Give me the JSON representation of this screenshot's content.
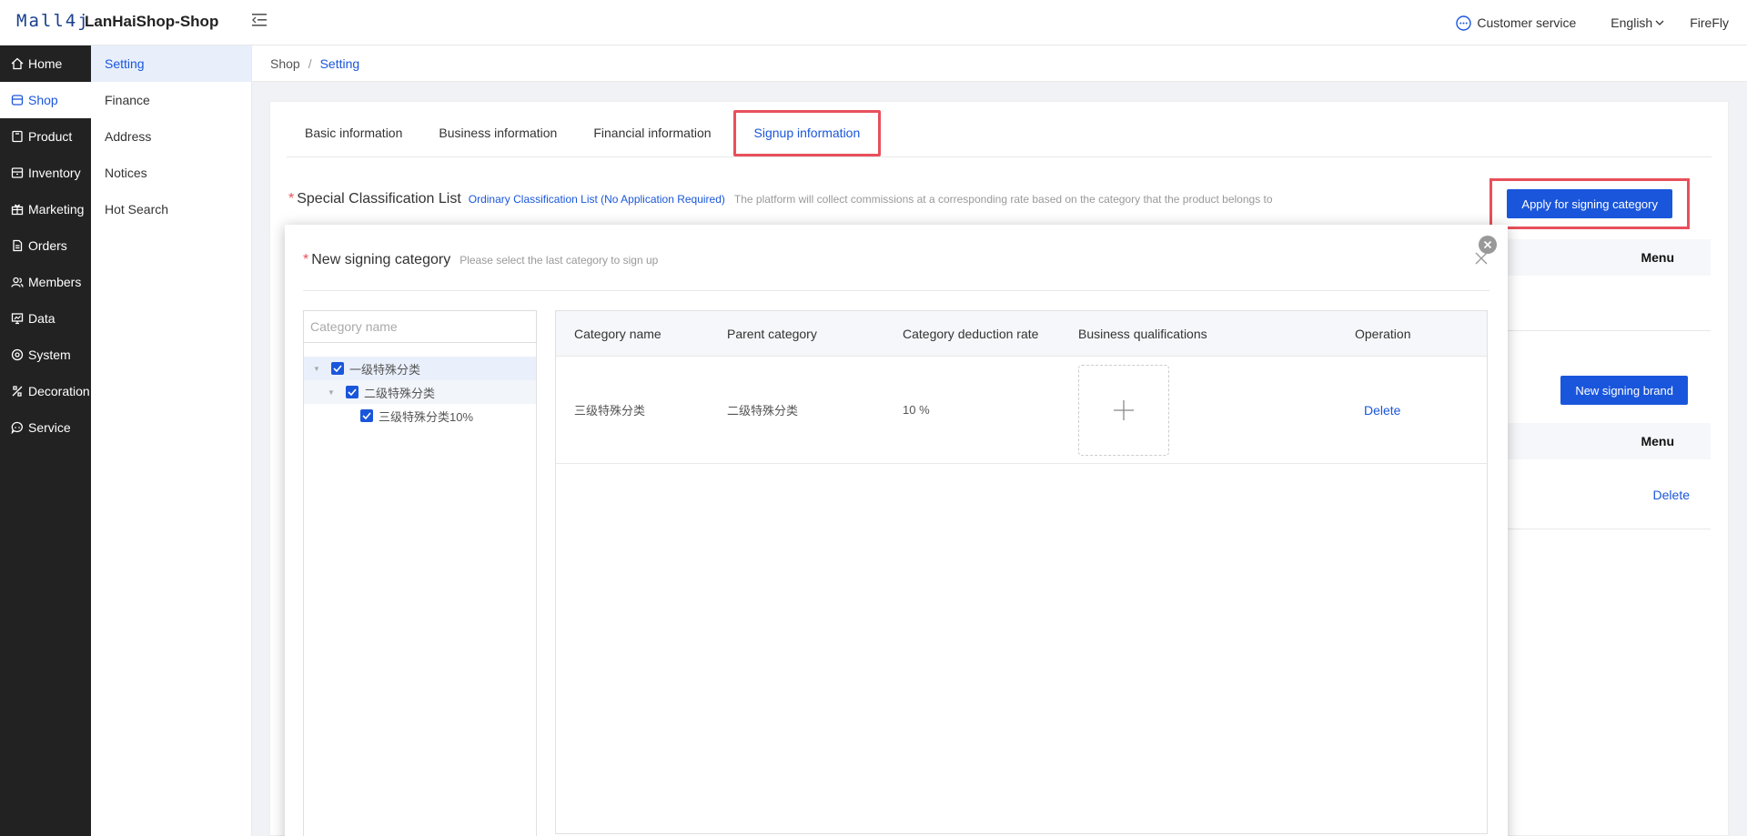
{
  "header": {
    "logo": "Mall4j",
    "app_title": "LanHaiShop-Shop",
    "customer_service": "Customer service",
    "language": "English",
    "user": "FireFly"
  },
  "nav": {
    "items": [
      {
        "label": "Home",
        "icon": "home-icon"
      },
      {
        "label": "Shop",
        "icon": "shop-icon"
      },
      {
        "label": "Product",
        "icon": "product-icon"
      },
      {
        "label": "Inventory",
        "icon": "inventory-icon"
      },
      {
        "label": "Marketing",
        "icon": "marketing-icon"
      },
      {
        "label": "Orders",
        "icon": "orders-icon"
      },
      {
        "label": "Members",
        "icon": "members-icon"
      },
      {
        "label": "Data",
        "icon": "data-icon"
      },
      {
        "label": "System",
        "icon": "system-icon"
      },
      {
        "label": "Decoration",
        "icon": "decoration-icon"
      },
      {
        "label": "Service",
        "icon": "service-icon"
      }
    ],
    "active": "Shop"
  },
  "subnav": {
    "items": [
      "Setting",
      "Finance",
      "Address",
      "Notices",
      "Hot Search"
    ],
    "active": "Setting"
  },
  "breadcrumb": {
    "root": "Shop",
    "sep": "/",
    "current": "Setting"
  },
  "tabs": [
    "Basic information",
    "Business information",
    "Financial information",
    "Signup information"
  ],
  "active_tab": "Signup information",
  "section": {
    "required_mark": "*",
    "title": "Special Classification List",
    "link": "Ordinary Classification List (No Application Required)",
    "hint": "The platform will collect commissions at a corresponding rate based on the category that the product belongs to",
    "apply_button": "Apply for signing category"
  },
  "background": {
    "menu_header_1": "Menu",
    "menu_header_2": "Menu",
    "new_brand_button": "New signing brand",
    "delete_link": "Delete"
  },
  "dialog": {
    "required_mark": "*",
    "title": "New signing category",
    "subtitle": "Please select the last category to sign up",
    "search_placeholder": "Category name",
    "tree": {
      "level1": "一级特殊分类",
      "level2": "二级特殊分类",
      "level3": "三级特殊分类10%"
    },
    "table": {
      "headers": [
        "Category name",
        "Parent category",
        "Category deduction rate",
        "Business qualifications",
        "Operation"
      ],
      "rows": [
        {
          "category": "三级特殊分类",
          "parent": "二级特殊分类",
          "rate": "10 %",
          "operation": "Delete"
        }
      ]
    }
  },
  "colors": {
    "primary": "#1a56db",
    "highlight": "#e8505b",
    "sidebar": "#222222"
  }
}
